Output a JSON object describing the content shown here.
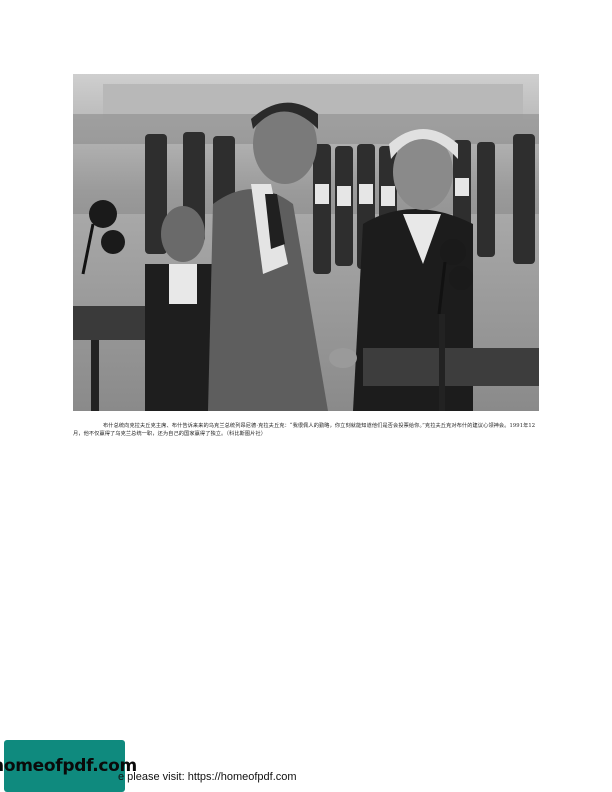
{
  "photo": {
    "alt": "Two statesmen shaking hands between podiums with microphones, honor guard in background"
  },
  "caption": {
    "text": "布什总统向克拉夫丘克主席、布什告诉来来的乌克兰总统列昂尼德·克拉夫丘克：“我很佩人的勤略，你立刻就能知道他们是否会投票给你。”克拉夫丘克对布什的建议心领神会。1991年12月，他不仅赢得了乌克兰总统一职，还为自己的国家赢得了独立。（科比斯图片社）"
  },
  "footer": {
    "logo_text": "homeofpdf.com",
    "text": "e please visit: https://homeofpdf.com"
  }
}
